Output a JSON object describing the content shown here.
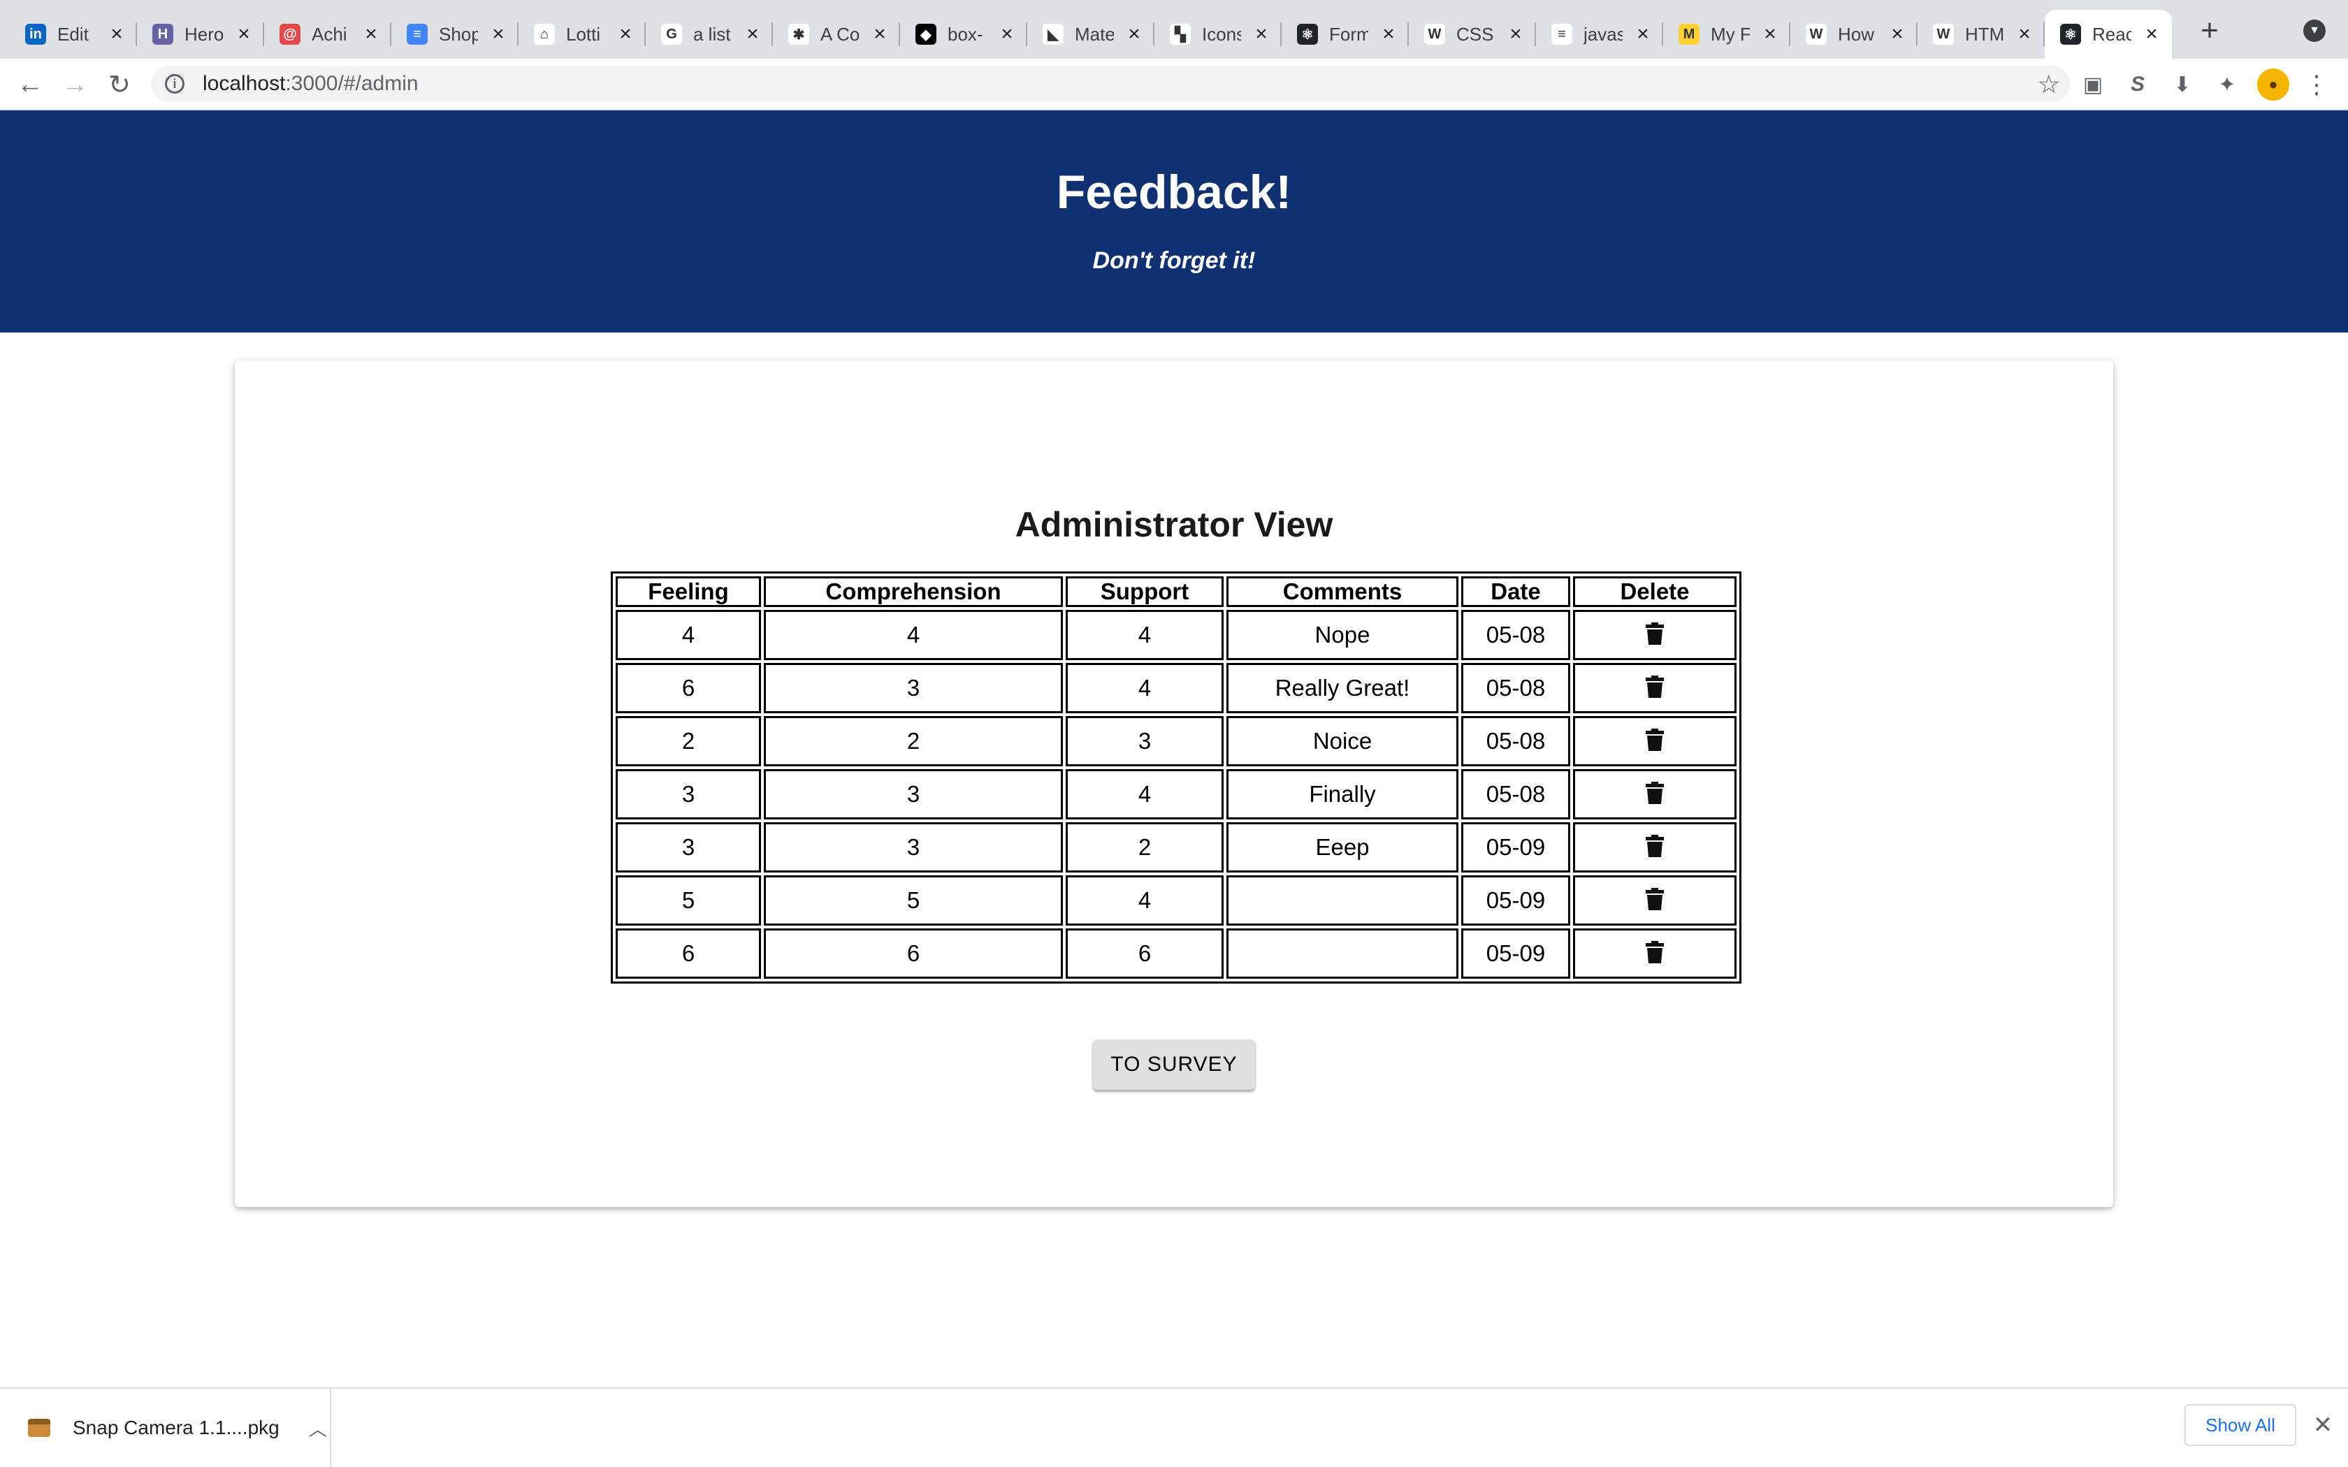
{
  "browser": {
    "tabs": [
      {
        "title": "Edit",
        "favicon": "linkedin-icon",
        "color": "#0a66c2",
        "glyph": "in"
      },
      {
        "title": "Hero",
        "favicon": "heroku-icon",
        "color": "#6762a6",
        "glyph": "H"
      },
      {
        "title": "Achi",
        "favicon": "spiral-icon",
        "color": "#e24a4a",
        "glyph": "@"
      },
      {
        "title": "Shop",
        "favicon": "google-docs-icon",
        "color": "#4285f4",
        "glyph": "≡"
      },
      {
        "title": "Lotti",
        "favicon": "airbnb-icon",
        "color": "#ffffff",
        "glyph": "⌂"
      },
      {
        "title": "a list",
        "favicon": "google-icon",
        "color": "#ffffff",
        "glyph": "G"
      },
      {
        "title": "A Co",
        "favicon": "asterisk-icon",
        "color": "#ffffff",
        "glyph": "✱"
      },
      {
        "title": "box-",
        "favicon": "codepen-icon",
        "color": "#000000",
        "glyph": "◆"
      },
      {
        "title": "Mate",
        "favicon": "material-ui-icon",
        "color": "#ffffff",
        "glyph": "◣"
      },
      {
        "title": "Icons",
        "favicon": "icons-icon",
        "color": "#ffffff",
        "glyph": "▚"
      },
      {
        "title": "Form",
        "favicon": "react-icon",
        "color": "#20232a",
        "glyph": "⚛"
      },
      {
        "title": "CSS",
        "favicon": "w3schools-icon",
        "color": "#ffffff",
        "glyph": "W"
      },
      {
        "title": "javas",
        "favicon": "stackoverflow-icon",
        "color": "#ffffff",
        "glyph": "≡"
      },
      {
        "title": "My F",
        "favicon": "miro-icon",
        "color": "#ffd02f",
        "glyph": "M"
      },
      {
        "title": "How",
        "favicon": "w3schools-icon",
        "color": "#ffffff",
        "glyph": "W"
      },
      {
        "title": "HTM",
        "favicon": "w3schools-icon",
        "color": "#ffffff",
        "glyph": "W"
      },
      {
        "title": "Reac",
        "favicon": "react-icon",
        "color": "#20232a",
        "glyph": "⚛",
        "active": true
      }
    ],
    "url_host": "localhost",
    "url_path": ":3000/#/admin"
  },
  "header": {
    "title": "Feedback!",
    "tagline": "Don't forget it!"
  },
  "admin": {
    "title": "Administrator View",
    "columns": [
      "Feeling",
      "Comprehension",
      "Support",
      "Comments",
      "Date",
      "Delete"
    ],
    "rows": [
      {
        "feeling": "4",
        "comprehension": "4",
        "support": "4",
        "comments": "Nope",
        "date": "05-08"
      },
      {
        "feeling": "6",
        "comprehension": "3",
        "support": "4",
        "comments": "Really Great!",
        "date": "05-08"
      },
      {
        "feeling": "2",
        "comprehension": "2",
        "support": "3",
        "comments": "Noice",
        "date": "05-08"
      },
      {
        "feeling": "3",
        "comprehension": "3",
        "support": "4",
        "comments": "Finally",
        "date": "05-08"
      },
      {
        "feeling": "3",
        "comprehension": "3",
        "support": "2",
        "comments": "Eeep",
        "date": "05-09"
      },
      {
        "feeling": "5",
        "comprehension": "5",
        "support": "4",
        "comments": "",
        "date": "05-09"
      },
      {
        "feeling": "6",
        "comprehension": "6",
        "support": "6",
        "comments": "",
        "date": "05-09"
      }
    ],
    "survey_button": "TO SURVEY"
  },
  "downloads": {
    "file_name": "Snap Camera 1.1....pkg",
    "show_all": "Show All"
  },
  "colors": {
    "header_bg": "#0f3172",
    "button_bg": "#e0e0e0",
    "link_blue": "#1a73e8"
  }
}
